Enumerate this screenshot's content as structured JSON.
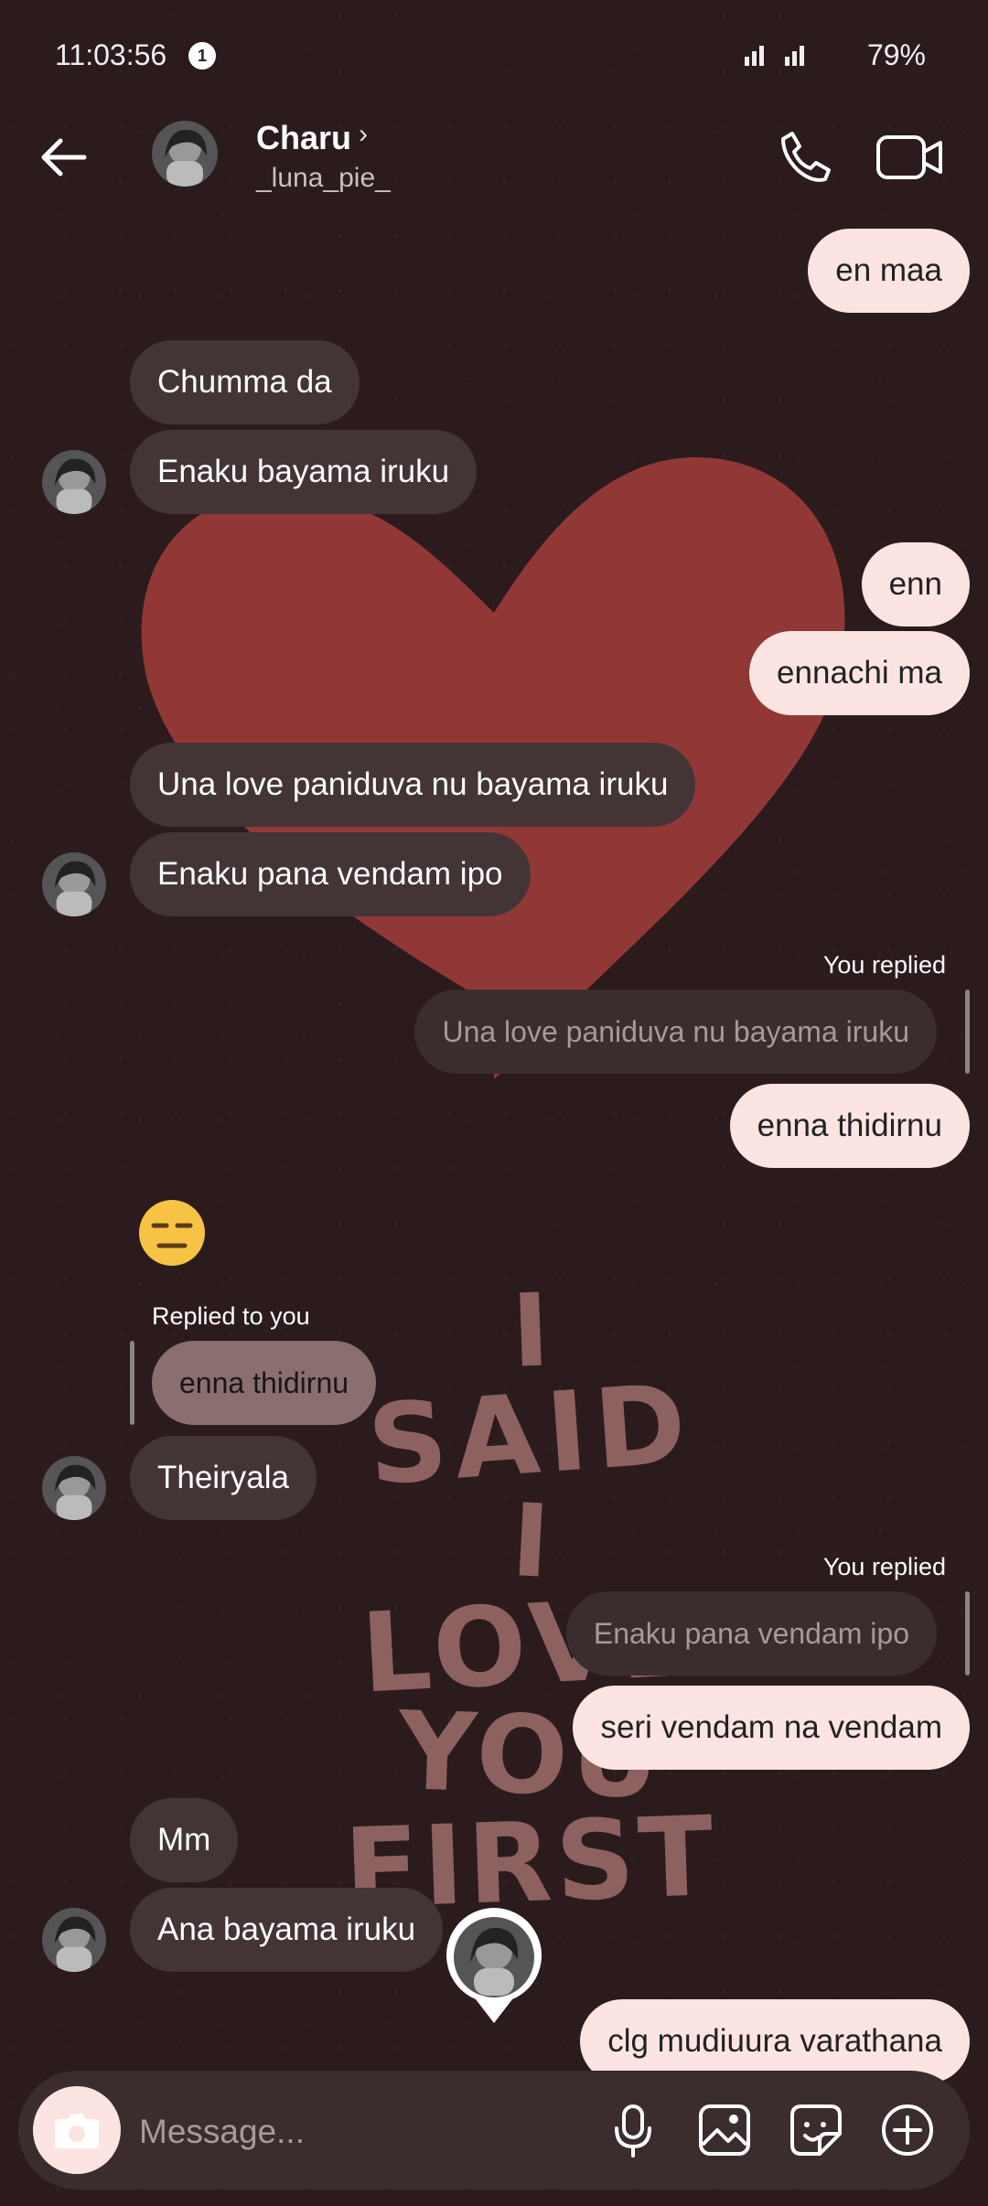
{
  "status_bar": {
    "time": "11:03:56",
    "notification_count": "1",
    "battery": "79%"
  },
  "header": {
    "contact_name": "Charu",
    "chevron": "›",
    "username": "_luna_pie_"
  },
  "wallpaper": {
    "text_lines": [
      "I",
      "SAID",
      "I",
      "LOVE",
      "YOU",
      "FIRST"
    ]
  },
  "messages": [
    {
      "id": "m1",
      "side": "out",
      "text": "en maa"
    },
    {
      "id": "m2",
      "side": "in",
      "text": "Chumma da"
    },
    {
      "id": "m3",
      "side": "in",
      "text": "Enaku bayama iruku"
    },
    {
      "id": "m4",
      "side": "out",
      "text": "enn"
    },
    {
      "id": "m5",
      "side": "out",
      "text": "ennachi ma"
    },
    {
      "id": "m6",
      "side": "in",
      "text": "Una love paniduva nu bayama iruku"
    },
    {
      "id": "m7",
      "side": "in",
      "text": "Enaku pana vendam ipo"
    },
    {
      "id": "m8",
      "side": "out",
      "reply_label": "You replied",
      "quoted": "Una love paniduva nu bayama iruku",
      "text": "enna thidirnu"
    },
    {
      "id": "m9",
      "side": "in",
      "emoji": "expressionless-face"
    },
    {
      "id": "m10",
      "side": "in",
      "reply_label": "Replied to you",
      "quoted": "enna thidirnu",
      "text": "Theiryala"
    },
    {
      "id": "m11",
      "side": "out",
      "reply_label": "You replied",
      "quoted": "Enaku pana vendam ipo",
      "text": "seri vendam na vendam"
    },
    {
      "id": "m12",
      "side": "in",
      "text": "Mm"
    },
    {
      "id": "m13",
      "side": "in",
      "text": "Ana bayama iruku"
    },
    {
      "id": "m14",
      "side": "out",
      "text": "clg mudiuura varathana"
    }
  ],
  "composer": {
    "placeholder": "Message..."
  },
  "icons": [
    "back-arrow-icon",
    "phone-icon",
    "video-camera-icon",
    "camera-icon",
    "microphone-icon",
    "gallery-icon",
    "sticker-icon",
    "plus-circle-icon"
  ],
  "colors": {
    "background": "#2b1b1d",
    "outgoing_bubble": "#fbe4e2",
    "incoming_bubble": "#433536",
    "heart": "#9c3c3a"
  }
}
